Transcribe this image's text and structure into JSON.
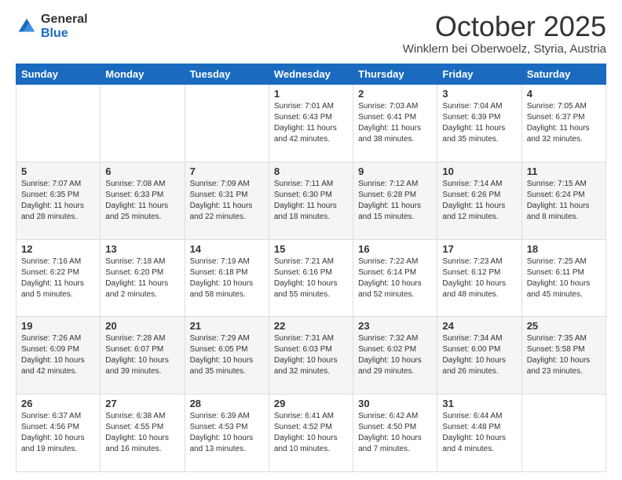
{
  "header": {
    "logo_general": "General",
    "logo_blue": "Blue",
    "month": "October 2025",
    "location": "Winklern bei Oberwoelz, Styria, Austria"
  },
  "days_of_week": [
    "Sunday",
    "Monday",
    "Tuesday",
    "Wednesday",
    "Thursday",
    "Friday",
    "Saturday"
  ],
  "weeks": [
    [
      {
        "day": "",
        "info": ""
      },
      {
        "day": "",
        "info": ""
      },
      {
        "day": "",
        "info": ""
      },
      {
        "day": "1",
        "info": "Sunrise: 7:01 AM\nSunset: 6:43 PM\nDaylight: 11 hours\nand 42 minutes."
      },
      {
        "day": "2",
        "info": "Sunrise: 7:03 AM\nSunset: 6:41 PM\nDaylight: 11 hours\nand 38 minutes."
      },
      {
        "day": "3",
        "info": "Sunrise: 7:04 AM\nSunset: 6:39 PM\nDaylight: 11 hours\nand 35 minutes."
      },
      {
        "day": "4",
        "info": "Sunrise: 7:05 AM\nSunset: 6:37 PM\nDaylight: 11 hours\nand 32 minutes."
      }
    ],
    [
      {
        "day": "5",
        "info": "Sunrise: 7:07 AM\nSunset: 6:35 PM\nDaylight: 11 hours\nand 28 minutes."
      },
      {
        "day": "6",
        "info": "Sunrise: 7:08 AM\nSunset: 6:33 PM\nDaylight: 11 hours\nand 25 minutes."
      },
      {
        "day": "7",
        "info": "Sunrise: 7:09 AM\nSunset: 6:31 PM\nDaylight: 11 hours\nand 22 minutes."
      },
      {
        "day": "8",
        "info": "Sunrise: 7:11 AM\nSunset: 6:30 PM\nDaylight: 11 hours\nand 18 minutes."
      },
      {
        "day": "9",
        "info": "Sunrise: 7:12 AM\nSunset: 6:28 PM\nDaylight: 11 hours\nand 15 minutes."
      },
      {
        "day": "10",
        "info": "Sunrise: 7:14 AM\nSunset: 6:26 PM\nDaylight: 11 hours\nand 12 minutes."
      },
      {
        "day": "11",
        "info": "Sunrise: 7:15 AM\nSunset: 6:24 PM\nDaylight: 11 hours\nand 8 minutes."
      }
    ],
    [
      {
        "day": "12",
        "info": "Sunrise: 7:16 AM\nSunset: 6:22 PM\nDaylight: 11 hours\nand 5 minutes."
      },
      {
        "day": "13",
        "info": "Sunrise: 7:18 AM\nSunset: 6:20 PM\nDaylight: 11 hours\nand 2 minutes."
      },
      {
        "day": "14",
        "info": "Sunrise: 7:19 AM\nSunset: 6:18 PM\nDaylight: 10 hours\nand 58 minutes."
      },
      {
        "day": "15",
        "info": "Sunrise: 7:21 AM\nSunset: 6:16 PM\nDaylight: 10 hours\nand 55 minutes."
      },
      {
        "day": "16",
        "info": "Sunrise: 7:22 AM\nSunset: 6:14 PM\nDaylight: 10 hours\nand 52 minutes."
      },
      {
        "day": "17",
        "info": "Sunrise: 7:23 AM\nSunset: 6:12 PM\nDaylight: 10 hours\nand 48 minutes."
      },
      {
        "day": "18",
        "info": "Sunrise: 7:25 AM\nSunset: 6:11 PM\nDaylight: 10 hours\nand 45 minutes."
      }
    ],
    [
      {
        "day": "19",
        "info": "Sunrise: 7:26 AM\nSunset: 6:09 PM\nDaylight: 10 hours\nand 42 minutes."
      },
      {
        "day": "20",
        "info": "Sunrise: 7:28 AM\nSunset: 6:07 PM\nDaylight: 10 hours\nand 39 minutes."
      },
      {
        "day": "21",
        "info": "Sunrise: 7:29 AM\nSunset: 6:05 PM\nDaylight: 10 hours\nand 35 minutes."
      },
      {
        "day": "22",
        "info": "Sunrise: 7:31 AM\nSunset: 6:03 PM\nDaylight: 10 hours\nand 32 minutes."
      },
      {
        "day": "23",
        "info": "Sunrise: 7:32 AM\nSunset: 6:02 PM\nDaylight: 10 hours\nand 29 minutes."
      },
      {
        "day": "24",
        "info": "Sunrise: 7:34 AM\nSunset: 6:00 PM\nDaylight: 10 hours\nand 26 minutes."
      },
      {
        "day": "25",
        "info": "Sunrise: 7:35 AM\nSunset: 5:58 PM\nDaylight: 10 hours\nand 23 minutes."
      }
    ],
    [
      {
        "day": "26",
        "info": "Sunrise: 6:37 AM\nSunset: 4:56 PM\nDaylight: 10 hours\nand 19 minutes."
      },
      {
        "day": "27",
        "info": "Sunrise: 6:38 AM\nSunset: 4:55 PM\nDaylight: 10 hours\nand 16 minutes."
      },
      {
        "day": "28",
        "info": "Sunrise: 6:39 AM\nSunset: 4:53 PM\nDaylight: 10 hours\nand 13 minutes."
      },
      {
        "day": "29",
        "info": "Sunrise: 6:41 AM\nSunset: 4:52 PM\nDaylight: 10 hours\nand 10 minutes."
      },
      {
        "day": "30",
        "info": "Sunrise: 6:42 AM\nSunset: 4:50 PM\nDaylight: 10 hours\nand 7 minutes."
      },
      {
        "day": "31",
        "info": "Sunrise: 6:44 AM\nSunset: 4:48 PM\nDaylight: 10 hours\nand 4 minutes."
      },
      {
        "day": "",
        "info": ""
      }
    ]
  ]
}
